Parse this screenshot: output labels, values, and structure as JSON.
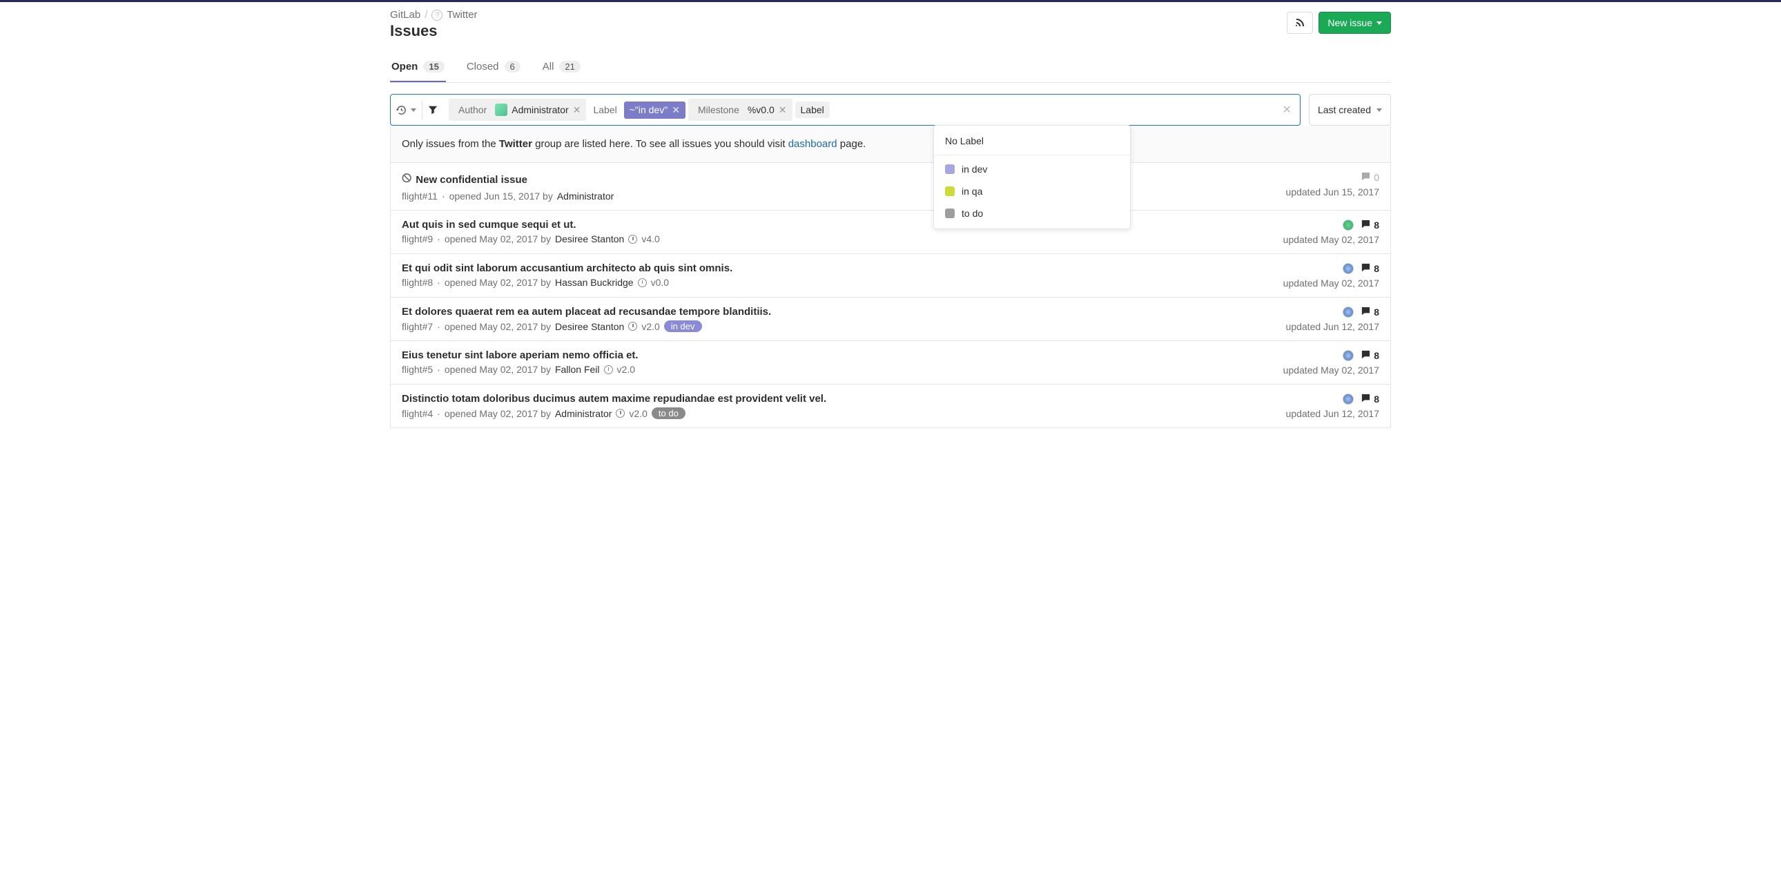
{
  "breadcrumbs": {
    "root": "GitLab",
    "group": "Twitter"
  },
  "page_title": "Issues",
  "actions": {
    "new_issue": "New issue"
  },
  "tabs": {
    "open": {
      "label": "Open",
      "count": "15"
    },
    "closed": {
      "label": "Closed",
      "count": "6"
    },
    "all": {
      "label": "All",
      "count": "21"
    }
  },
  "filter": {
    "author_label": "Author",
    "author_value": "Administrator",
    "label_label": "Label",
    "label_token": "~\"in dev\"",
    "milestone_label": "Milestone",
    "milestone_value": "%v0.0",
    "trailing_label": "Label"
  },
  "sort": {
    "value": "Last created"
  },
  "dropdown": {
    "no_label": "No Label",
    "items": [
      {
        "name": "in dev",
        "color": "#a6a6e0"
      },
      {
        "name": "in qa",
        "color": "#cddc39"
      },
      {
        "name": "to do",
        "color": "#9e9e9e"
      }
    ]
  },
  "banner": {
    "prefix": "Only issues from the ",
    "group": "Twitter",
    "mid": " group are listed here. To see all issues you should visit ",
    "link": "dashboard",
    "suffix": " page."
  },
  "issues": [
    {
      "confidential": true,
      "title": "New confidential issue",
      "ref": "flight#11",
      "opened": "opened Jun 15, 2017 by",
      "author": "Administrator",
      "milestone": "",
      "labels": [],
      "comments": "0",
      "comments_muted": true,
      "assignee": "",
      "updated": "updated Jun 15, 2017"
    },
    {
      "title": "Aut quis in sed cumque sequi et ut.",
      "ref": "flight#9",
      "opened": "opened May 02, 2017 by",
      "author": "Desiree Stanton",
      "milestone": "v4.0",
      "labels": [],
      "comments": "8",
      "assignee": "green",
      "updated": "updated May 02, 2017"
    },
    {
      "title": "Et qui odit sint laborum accusantium architecto ab quis sint omnis.",
      "ref": "flight#8",
      "opened": "opened May 02, 2017 by",
      "author": "Hassan Buckridge",
      "milestone": "v0.0",
      "labels": [],
      "comments": "8",
      "assignee": "blue",
      "updated": "updated May 02, 2017"
    },
    {
      "title": "Et dolores quaerat rem ea autem placeat ad recusandae tempore blanditiis.",
      "ref": "flight#7",
      "opened": "opened May 02, 2017 by",
      "author": "Desiree Stanton",
      "milestone": "v2.0",
      "labels": [
        {
          "text": "in dev",
          "bg": "#8a8ad6"
        }
      ],
      "comments": "8",
      "assignee": "blue",
      "updated": "updated Jun 12, 2017"
    },
    {
      "title": "Eius tenetur sint labore aperiam nemo officia et.",
      "ref": "flight#5",
      "opened": "opened May 02, 2017 by",
      "author": "Fallon Feil",
      "milestone": "v2.0",
      "labels": [],
      "comments": "8",
      "assignee": "blue",
      "updated": "updated May 02, 2017"
    },
    {
      "title": "Distinctio totam doloribus ducimus autem maxime repudiandae est provident velit vel.",
      "ref": "flight#4",
      "opened": "opened May 02, 2017 by",
      "author": "Administrator",
      "milestone": "v2.0",
      "labels": [
        {
          "text": "to do",
          "bg": "#8a8a8a"
        }
      ],
      "comments": "8",
      "assignee": "blue",
      "updated": "updated Jun 12, 2017"
    }
  ]
}
